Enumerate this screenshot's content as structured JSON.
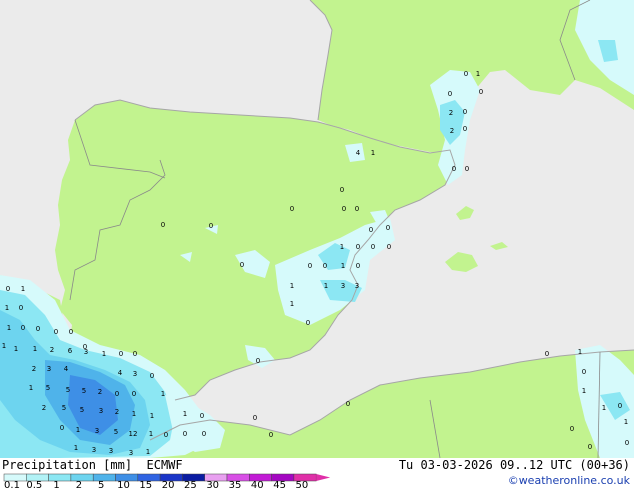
{
  "map": {
    "colors": {
      "sea": "#ebebeb",
      "land": "#c2f38f",
      "border": "#8a8a8a",
      "coast": "#a8a8a8"
    },
    "point_labels": [
      "0",
      "1",
      "2",
      "3",
      "4",
      "5",
      "6",
      "8",
      "12"
    ]
  },
  "legend": {
    "title": "Precipitation [mm]",
    "model": "ECMWF",
    "ticks": [
      "0.1",
      "0.5",
      "1",
      "2",
      "5",
      "10",
      "15",
      "20",
      "25",
      "30",
      "35",
      "40",
      "45",
      "50"
    ],
    "colors": [
      "#d6fafb",
      "#b2f2f6",
      "#8ce7f3",
      "#6dd4ef",
      "#4fb3ea",
      "#3e8fe6",
      "#2f63e2",
      "#1a35c8",
      "#0a1ca2",
      "#e8a0f0",
      "#d84fe6",
      "#c21bd6",
      "#a407c2",
      "#e02fa8"
    ]
  },
  "header": {
    "valid": "Tu 03-03-2026 09..12 UTC (00+36)"
  },
  "credit": "©weatheronline.co.uk"
}
